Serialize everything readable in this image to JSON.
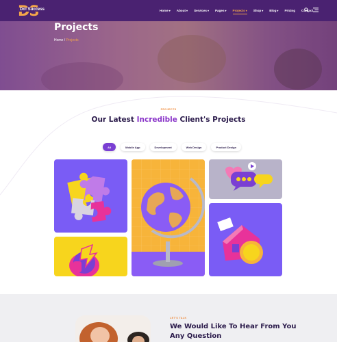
{
  "header": {
    "logo": {
      "mark": "DS",
      "text": "Do! Success"
    },
    "nav": [
      {
        "label": "Home",
        "caret": true,
        "active": false
      },
      {
        "label": "About",
        "caret": true,
        "active": false
      },
      {
        "label": "Services",
        "caret": true,
        "active": false
      },
      {
        "label": "Pages",
        "caret": true,
        "active": false
      },
      {
        "label": "Projects",
        "caret": true,
        "active": true
      },
      {
        "label": "Shop",
        "caret": true,
        "active": false
      },
      {
        "label": "Blog",
        "caret": true,
        "active": false
      },
      {
        "label": "Pricing",
        "caret": false,
        "active": false
      },
      {
        "label": "Contact",
        "caret": false,
        "active": false
      }
    ],
    "icons": [
      "search-icon",
      "menu-icon"
    ]
  },
  "hero": {
    "title": "Projects",
    "breadcrumb": {
      "home": "Home",
      "separator": "/",
      "current": "Projects"
    }
  },
  "projects": {
    "eyebrow": "PROJECTS",
    "title_pre": "Our Latest ",
    "title_highlight": "Incredible",
    "title_post": " Client's Projects",
    "filters": [
      {
        "label": "All",
        "active": true
      },
      {
        "label": "Mobile App",
        "active": false
      },
      {
        "label": "Development",
        "active": false
      },
      {
        "label": "Web Design",
        "active": false
      },
      {
        "label": "Product Design",
        "active": false
      }
    ],
    "cards": [
      "puzzle-image",
      "gadget-image",
      "globe-image",
      "chat-bubbles-image",
      "house-coin-image"
    ]
  },
  "contact": {
    "eyebrow": "LET'S TALK",
    "title": "We Would Like To Hear From You Any Question"
  },
  "colors": {
    "header_bg": "#4a2271",
    "accent_orange": "#f4a64a",
    "accent_purple": "#7a3fd3",
    "highlight": "#8a35c9",
    "card_purple": "#7a5cf5",
    "card_yellow": "#f7d51d"
  }
}
